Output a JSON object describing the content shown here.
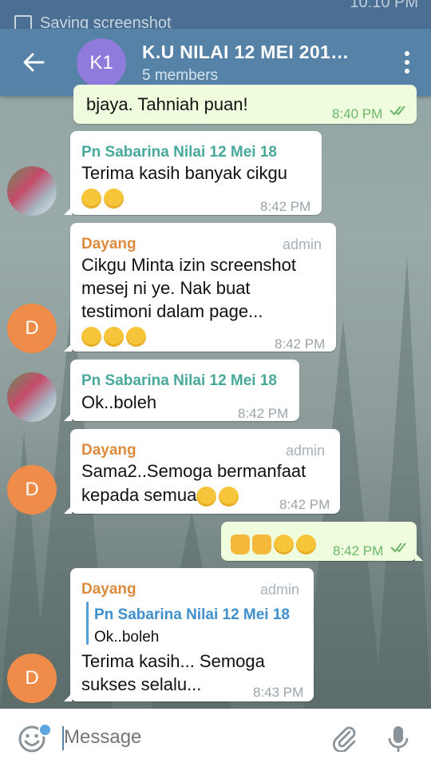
{
  "status_bar": {
    "notification": "Saving screenshot",
    "clock": "10:10 PM"
  },
  "header": {
    "avatar_initials": "K1",
    "title": "K.U NILAI 12 MEI 201…",
    "subtitle": "5 members"
  },
  "messages": [
    {
      "direction": "out",
      "text_lines": [
        "bjaya. Tahniah puan!"
      ],
      "time": "8:40 PM",
      "read": true
    },
    {
      "direction": "in",
      "sender": "Pn Sabarina Nilai 12 Mei 18",
      "text_lines": [
        "Terima kasih banyak cikgu"
      ],
      "emoji": [
        "heart-eyes",
        "kissing-heart"
      ],
      "time": "8:42 PM"
    },
    {
      "direction": "in",
      "sender": "Dayang",
      "role": "admin",
      "avatar_initial": "D",
      "text_lines": [
        "Cikgu Minta izin screenshot",
        "mesej ni ye. Nak buat",
        "testimoni dalam page..."
      ],
      "emoji": [
        "smiling",
        "smiling",
        "grinning"
      ],
      "time": "8:42 PM"
    },
    {
      "direction": "in",
      "sender": "Pn Sabarina Nilai 12 Mei 18",
      "text_lines": [
        "Ok..boleh"
      ],
      "time": "8:42 PM"
    },
    {
      "direction": "in",
      "sender": "Dayang",
      "role": "admin",
      "avatar_initial": "D",
      "text_lines": [
        "Sama2..Semoga bermanfaat",
        "kepada semua"
      ],
      "emoji": [
        "kissing-heart",
        "kissing-heart"
      ],
      "time": "8:42 PM"
    },
    {
      "direction": "out",
      "text_lines": [
        ""
      ],
      "emoji": [
        "thumbs-up",
        "thumbs-up",
        "heart-eyes",
        "heart-eyes"
      ],
      "time": "8:42 PM",
      "read": true
    },
    {
      "direction": "in",
      "sender": "Dayang",
      "role": "admin",
      "avatar_initial": "D",
      "reply_to": {
        "sender": "Pn Sabarina Nilai 12 Mei 18",
        "text": "Ok..boleh"
      },
      "text_lines": [
        "Terima kasih...  Semoga",
        "sukses selalu..."
      ],
      "time": "8:43 PM"
    }
  ],
  "input": {
    "placeholder": "Message"
  },
  "colors": {
    "header": "#5682a8",
    "sender_green": "#47a89b",
    "sender_orange": "#dd8a3d",
    "outgoing_bubble": "#effdde",
    "avatar_d": "#ef8c4a",
    "avatar_k1": "#8e7bdc"
  }
}
